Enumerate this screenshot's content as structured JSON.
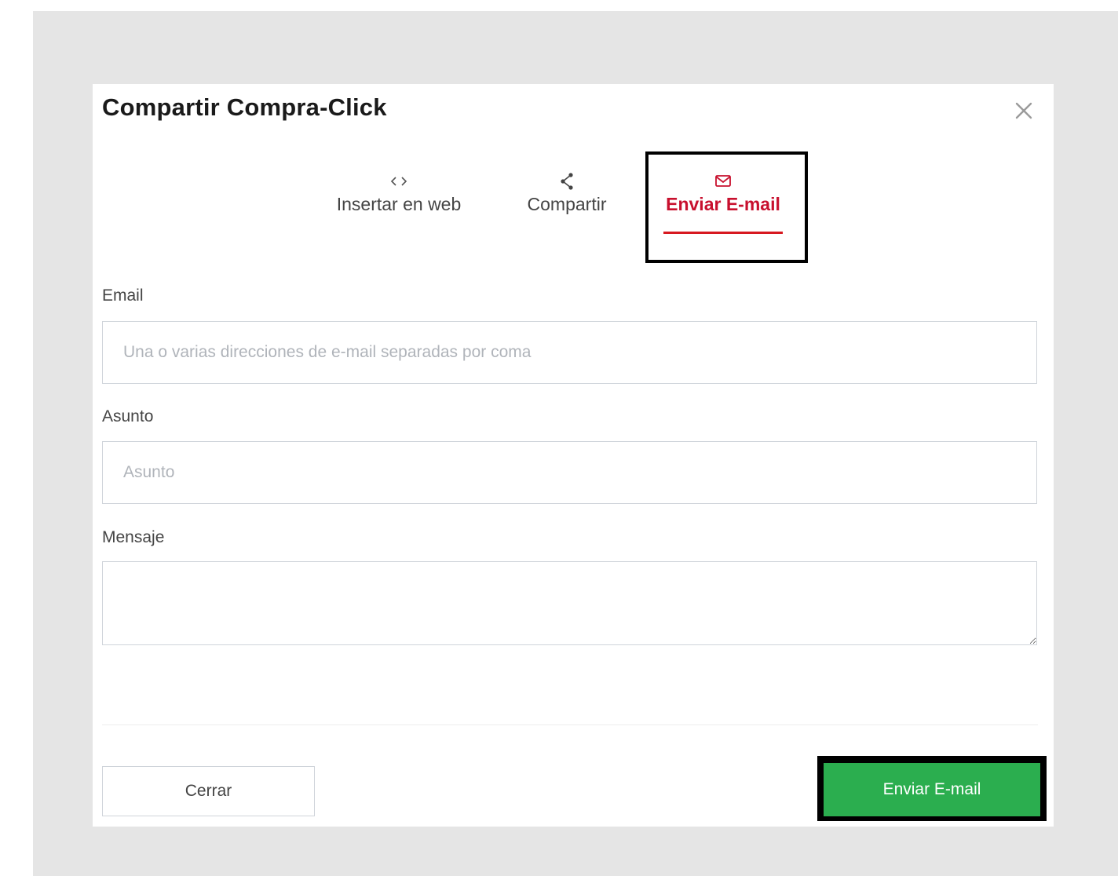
{
  "modal": {
    "title": "Compartir Compra-Click",
    "close_icon": "close-icon"
  },
  "tabs": [
    {
      "label": "Insertar en web",
      "icon": "code-icon",
      "active": false
    },
    {
      "label": "Compartir",
      "icon": "share-icon",
      "active": false
    },
    {
      "label": "Enviar E-mail",
      "icon": "envelope-icon",
      "active": true
    }
  ],
  "form": {
    "email": {
      "label": "Email",
      "placeholder": "Una o varias direcciones de e-mail separadas por coma",
      "value": ""
    },
    "subject": {
      "label": "Asunto",
      "placeholder": "Asunto",
      "value": ""
    },
    "message": {
      "label": "Mensaje",
      "value": ""
    }
  },
  "footer": {
    "close_label": "Cerrar",
    "send_label": "Enviar E-mail"
  },
  "colors": {
    "accent_red": "#d71920",
    "send_green": "#2bae4f",
    "backdrop": "#e5e5e5",
    "highlight_border": "#000000"
  }
}
